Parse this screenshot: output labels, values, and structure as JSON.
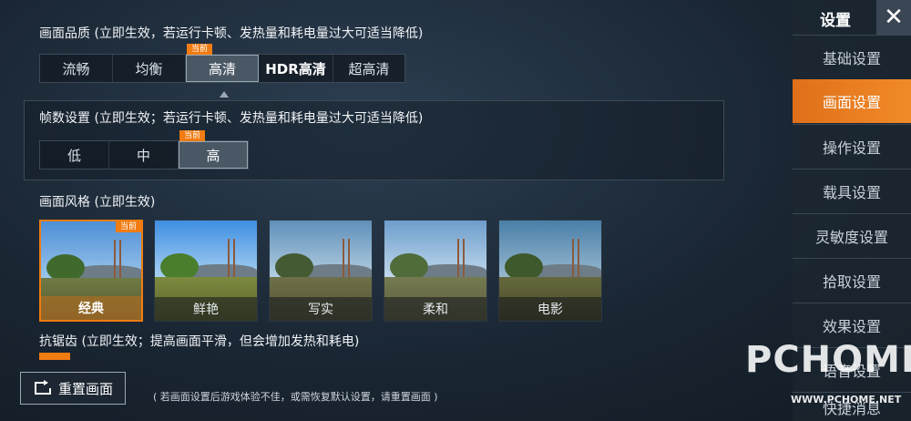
{
  "current_tag": "当前",
  "quality": {
    "title": "画面品质 (立即生效，若运行卡顿、发热量和耗电量过大可适当降低)",
    "options": [
      "流畅",
      "均衡",
      "高清",
      "HDR高清",
      "超高清"
    ],
    "selected": "高清"
  },
  "fps": {
    "title": "帧数设置 (立即生效；若运行卡顿、发热量和耗电量过大可适当降低)",
    "options": [
      "低",
      "中",
      "高"
    ],
    "selected": "高"
  },
  "style": {
    "title": "画面风格 (立即生效)",
    "options": [
      "经典",
      "鲜艳",
      "写实",
      "柔和",
      "电影"
    ],
    "selected": "经典"
  },
  "antialias": {
    "title": "抗锯齿 (立即生效；提高画面平滑，但会增加发热和耗电)"
  },
  "reset": {
    "label": "重置画面",
    "hint": "( 若画面设置后游戏体验不佳，或需恢复默认设置，请重置画面 )"
  },
  "sidebar": {
    "title": "设置",
    "close_glyph": "✕",
    "items": [
      "基础设置",
      "画面设置",
      "操作设置",
      "载具设置",
      "灵敏度设置",
      "拾取设置",
      "效果设置",
      "语音设置",
      "快捷消息"
    ],
    "active": "画面设置"
  },
  "watermark": {
    "brand": "PCHOME",
    "url": "WWW.PCHOME.NET"
  },
  "colors": {
    "accent": "#f07c12",
    "active_menu": "#e8781f"
  }
}
